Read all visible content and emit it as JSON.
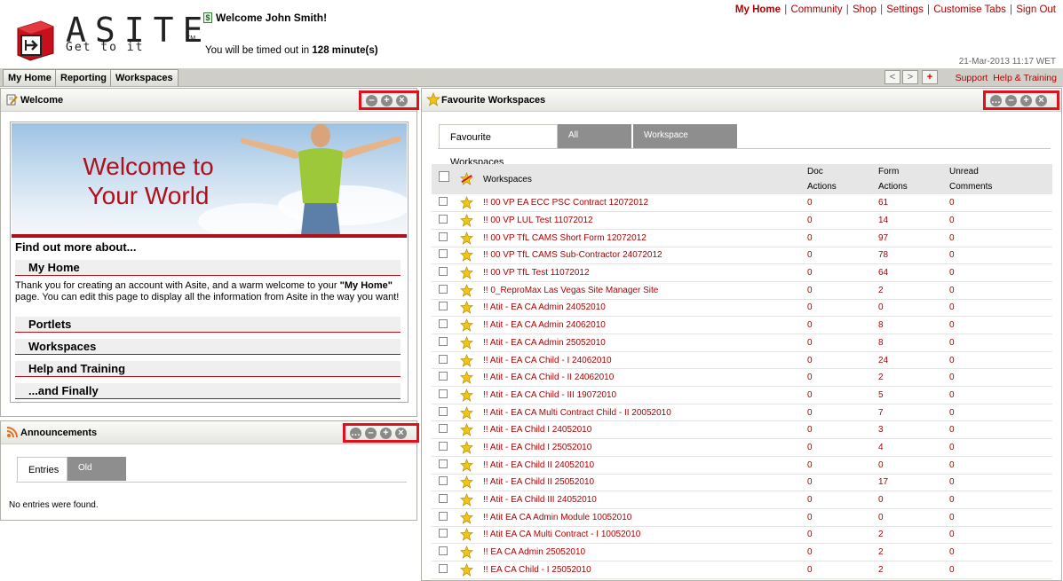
{
  "header": {
    "logo_text": "ASITE",
    "logo_tm": "TM",
    "logo_tagline": "Get to it",
    "welcome": "Welcome John Smith!",
    "dollar_icon": "$",
    "timeout_prefix": "You will be timed out in",
    "timeout_value": "128 minute(s)",
    "links": {
      "my_home": "My Home",
      "community": "Community",
      "shop": "Shop",
      "settings": "Settings",
      "customise_tabs": "Customise Tabs",
      "sign_out": "Sign Out",
      "separator": "|"
    },
    "datetime": "21-Mar-2013 11:17 WET"
  },
  "tabs": {
    "my_home": "My Home",
    "reporting": "Reporting",
    "workspaces": "Workspaces",
    "nav_prev": "<",
    "nav_next": ">",
    "nav_add": "+",
    "support": "Support",
    "help_training": "Help & Training"
  },
  "portlet_controls": {
    "more": "…",
    "minimize": "–",
    "maximize": "+",
    "close": "×"
  },
  "welcome_portlet": {
    "title": "Welcome",
    "banner_line1": "Welcome to",
    "banner_line2": "Your World",
    "find_out": "Find out more about...",
    "sections": {
      "my_home": "My Home",
      "portlets": "Portlets",
      "workspaces": "Workspaces",
      "help_training": "Help and Training",
      "and_finally": "...and Finally"
    },
    "paragraph_prefix": "Thank you for creating an account with Asite, and a warm welcome to your ",
    "paragraph_bold": "\"My Home\"",
    "paragraph_suffix": " page. You can edit this page to display all the information from Asite in the way you want!"
  },
  "announcements": {
    "title": "Announcements",
    "tab_entries": "Entries",
    "tab_old": "Old Entries",
    "empty": "No entries were found."
  },
  "favourites": {
    "title": "Favourite Workspaces",
    "tab_fav": "Favourite Workspaces",
    "tab_all": "All Workspaces",
    "tab_templates": "Workspace Templates",
    "columns": {
      "workspaces": "Workspaces",
      "doc_l1": "Doc",
      "doc_l2": "Actions",
      "form_l1": "Form",
      "form_l2": "Actions",
      "unread_l1": "Unread",
      "unread_l2": "Comments"
    },
    "rows": [
      {
        "name": "!! 00 VP EA ECC PSC Contract 12072012",
        "doc": "0",
        "form": "61",
        "comments": "0"
      },
      {
        "name": "!! 00 VP LUL Test 11072012",
        "doc": "0",
        "form": "14",
        "comments": "0"
      },
      {
        "name": "!! 00 VP TfL CAMS Short Form 12072012",
        "doc": "0",
        "form": "97",
        "comments": "0"
      },
      {
        "name": "!! 00 VP TfL CAMS Sub-Contractor 24072012",
        "doc": "0",
        "form": "78",
        "comments": "0"
      },
      {
        "name": "!! 00 VP TfL Test 11072012",
        "doc": "0",
        "form": "64",
        "comments": "0"
      },
      {
        "name": "!! 0_ReproMax Las Vegas Site Manager Site",
        "doc": "0",
        "form": "2",
        "comments": "0"
      },
      {
        "name": "!! Atit - EA CA Admin 24052010",
        "doc": "0",
        "form": "0",
        "comments": "0"
      },
      {
        "name": "!! Atit - EA CA Admin 24062010",
        "doc": "0",
        "form": "8",
        "comments": "0"
      },
      {
        "name": "!! Atit - EA CA Admin 25052010",
        "doc": "0",
        "form": "8",
        "comments": "0"
      },
      {
        "name": "!! Atit - EA CA Child - I 24062010",
        "doc": "0",
        "form": "24",
        "comments": "0"
      },
      {
        "name": "!! Atit - EA CA Child - II 24062010",
        "doc": "0",
        "form": "2",
        "comments": "0"
      },
      {
        "name": "!! Atit - EA CA Child - III 19072010",
        "doc": "0",
        "form": "5",
        "comments": "0"
      },
      {
        "name": "!! Atit - EA CA Multi Contract Child - II 20052010",
        "doc": "0",
        "form": "7",
        "comments": "0"
      },
      {
        "name": "!! Atit - EA Child I 24052010",
        "doc": "0",
        "form": "3",
        "comments": "0"
      },
      {
        "name": "!! Atit - EA Child I 25052010",
        "doc": "0",
        "form": "4",
        "comments": "0"
      },
      {
        "name": "!! Atit - EA Child II 24052010",
        "doc": "0",
        "form": "0",
        "comments": "0"
      },
      {
        "name": "!! Atit - EA Child II 25052010",
        "doc": "0",
        "form": "17",
        "comments": "0"
      },
      {
        "name": "!! Atit - EA Child III 24052010",
        "doc": "0",
        "form": "0",
        "comments": "0"
      },
      {
        "name": "!! Atit EA CA Admin Module 10052010",
        "doc": "0",
        "form": "0",
        "comments": "0"
      },
      {
        "name": "!! Atit EA CA Multi Contract - I 10052010",
        "doc": "0",
        "form": "2",
        "comments": "0"
      },
      {
        "name": "!! EA CA Admin 25052010",
        "doc": "0",
        "form": "2",
        "comments": "0"
      },
      {
        "name": "!! EA CA Child - I 25052010",
        "doc": "0",
        "form": "2",
        "comments": "0"
      }
    ]
  },
  "colors": {
    "brand_red": "#b0101c",
    "link_red": "#b00000",
    "highlight_box": "#e0101c",
    "star_gold": "#f2c417"
  },
  "icons": {
    "logo": "asite-logo-icon",
    "dollar": "dollar-icon",
    "welcome_title": "edit-page-icon",
    "announcements_title": "rss-feed-icon",
    "favourites_title": "star-icon",
    "row_favourite": "star-icon",
    "header_select_all": "star-icon"
  }
}
